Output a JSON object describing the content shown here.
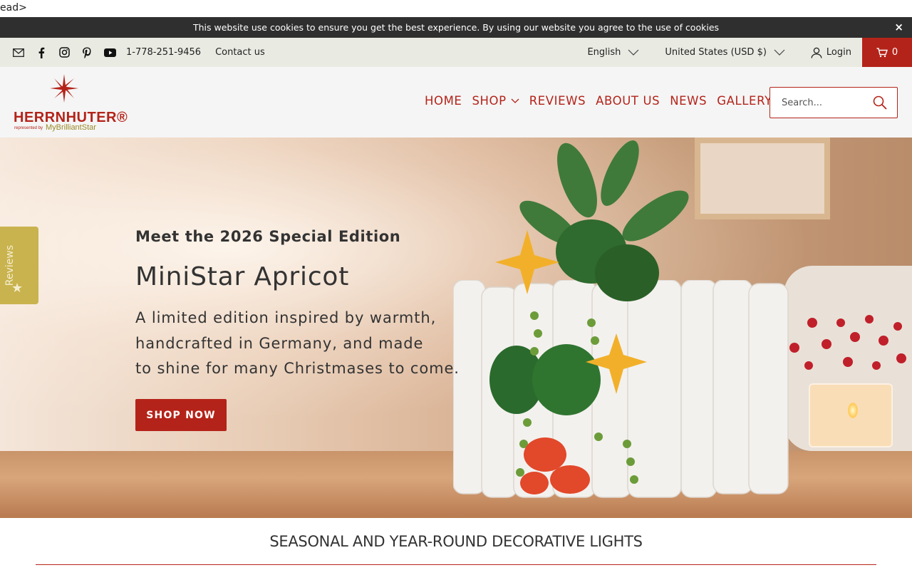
{
  "stray_text": "ead>",
  "cookie": {
    "message": "This website use cookies to ensure you get the best experience. By using our website you agree to the use of cookies",
    "close": "×"
  },
  "topbar": {
    "phone": "1-778-251-9456",
    "contact": "Contact us",
    "language": "English",
    "currency": "United States (USD $)",
    "login": "Login",
    "cart_count": "0"
  },
  "logo": {
    "word": "HERRNHUTER®",
    "sub": "represented by",
    "brand": "MyBrilliantStar"
  },
  "nav": {
    "home": "HOME",
    "shop": "SHOP",
    "reviews": "REVIEWS",
    "about": "ABOUT US",
    "news": "NEWS",
    "gallery": "GALLERY"
  },
  "search": {
    "placeholder": "Search..."
  },
  "reviews_tab": {
    "label": "Reviews",
    "star": "★"
  },
  "hero": {
    "kicker": "Meet the 2026 Special Edition",
    "title": "MiniStar Apricot",
    "desc": [
      "A limited edition inspired by warmth,",
      "handcrafted in Germany, and made",
      "to shine for many Christmases to come."
    ],
    "cta": "SHOP NOW"
  },
  "section": {
    "title": "SEASONAL AND YEAR-ROUND DECORATIVE LIGHTS"
  },
  "colors": {
    "brand_red": "#b42319",
    "reviews_gold": "#c9b34e",
    "topbar_bg": "#e9ebe3",
    "cookie_bg": "#2f2f2f"
  }
}
